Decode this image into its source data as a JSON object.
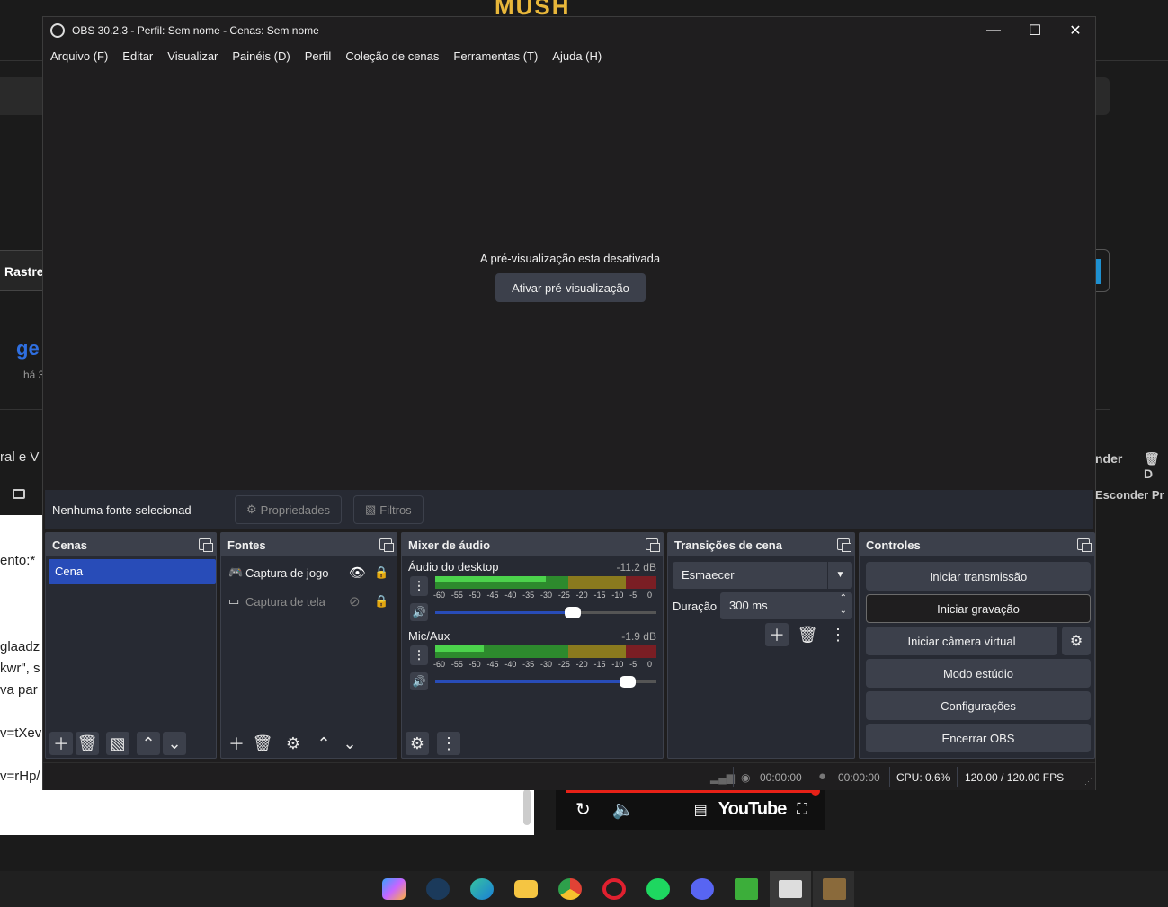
{
  "background": {
    "logo_text": "MUSH",
    "left_tab": "Rastre",
    "channel_text": "ge",
    "time_text": "há 3",
    "doc_lines": [
      "ento:*",
      "glaadz",
      "kwr\", s",
      "va par",
      "v=tXev",
      "v=rHp/"
    ],
    "left_heading": "ral e V",
    "right_action1": "nder",
    "right_action2": "D",
    "right_action3": "Esconder Pr",
    "video_brand": "YouTube"
  },
  "window": {
    "title": "OBS 30.2.3 - Perfil: Sem nome - Cenas: Sem nome",
    "minimize": "—",
    "maximize": "☐",
    "close": "✕"
  },
  "menu": [
    "Arquivo (F)",
    "Editar",
    "Visualizar",
    "Painéis (D)",
    "Perfil",
    "Coleção de cenas",
    "Ferramentas (T)",
    "Ajuda (H)"
  ],
  "preview": {
    "message": "A pré-visualização esta desativada",
    "button": "Ativar pré-visualização"
  },
  "source_bar": {
    "label": "Nenhuma fonte selecionad",
    "properties": "Propriedades",
    "filters": "Filtros"
  },
  "scenes": {
    "title": "Cenas",
    "items": [
      "Cena"
    ]
  },
  "sources": {
    "title": "Fontes",
    "items": [
      {
        "label": "Captura de jogo",
        "visible": true
      },
      {
        "label": "Captura de tela",
        "visible": false
      }
    ]
  },
  "mixer": {
    "title": "Mixer de áudio",
    "channels": [
      {
        "name": "Áudio do desktop",
        "db": "-11.2 dB",
        "volume": 0.62,
        "level": 0.5
      },
      {
        "name": "Mic/Aux",
        "db": "-1.9 dB",
        "volume": 0.87,
        "level": 0.22
      }
    ],
    "scale": [
      "-60",
      "-55",
      "-50",
      "-45",
      "-40",
      "-35",
      "-30",
      "-25",
      "-20",
      "-15",
      "-10",
      "-5",
      "0"
    ]
  },
  "transitions": {
    "title": "Transições de cena",
    "selected": "Esmaecer",
    "duration_label": "Duração",
    "duration_value": "300 ms"
  },
  "controls": {
    "title": "Controles",
    "buttons": [
      "Iniciar transmissão",
      "Iniciar gravação",
      "Iniciar câmera virtual",
      "Modo estúdio",
      "Configurações",
      "Encerrar OBS"
    ]
  },
  "status": {
    "stream_time": "00:00:00",
    "rec_time": "00:00:00",
    "cpu": "CPU: 0.6%",
    "fps": "120.00 / 120.00 FPS"
  }
}
